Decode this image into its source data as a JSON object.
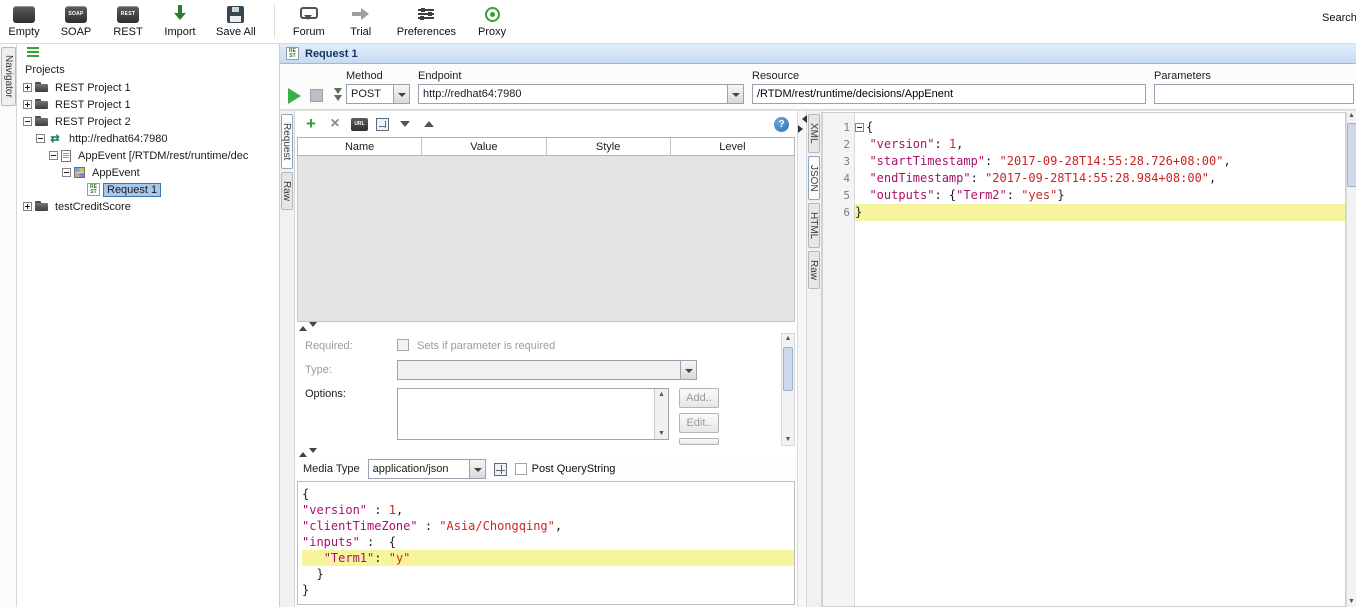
{
  "toolbar": {
    "items": [
      {
        "label": "Empty",
        "icon": "empty-project-icon"
      },
      {
        "label": "SOAP",
        "icon": "soap-project-icon"
      },
      {
        "label": "REST",
        "icon": "rest-project-icon"
      },
      {
        "label": "Import",
        "icon": "import-icon"
      },
      {
        "label": "Save All",
        "icon": "save-all-icon"
      },
      {
        "label": "Forum",
        "icon": "forum-icon"
      },
      {
        "label": "Trial",
        "icon": "trial-icon"
      },
      {
        "label": "Preferences",
        "icon": "preferences-icon"
      },
      {
        "label": "Proxy",
        "icon": "proxy-icon"
      }
    ],
    "search_label": "Search Forum"
  },
  "navigator": {
    "tab_label": "Navigator",
    "header": "Projects",
    "tree": [
      {
        "label": "REST Project 1",
        "icon": "folder",
        "level": 1,
        "expander": "collapsed",
        "selected": false
      },
      {
        "label": "REST Project 1",
        "icon": "folder",
        "level": 1,
        "expander": "collapsed",
        "selected": false
      },
      {
        "label": "REST Project 2",
        "icon": "folder",
        "level": 1,
        "expander": "expanded",
        "selected": false
      },
      {
        "label": "http://redhat64:7980",
        "icon": "service",
        "level": 2,
        "expander": "expanded",
        "selected": false
      },
      {
        "label": "AppEvent [/RTDM/rest/runtime/dec",
        "icon": "resource",
        "level": 3,
        "expander": "expanded",
        "selected": false
      },
      {
        "label": "AppEvent",
        "icon": "method",
        "level": 4,
        "expander": "expanded",
        "selected": false
      },
      {
        "label": "Request 1",
        "icon": "request",
        "level": 5,
        "expander": "none",
        "selected": true
      },
      {
        "label": "testCreditScore",
        "icon": "folder",
        "level": 1,
        "expander": "collapsed",
        "selected": false
      }
    ]
  },
  "request_window": {
    "title": "Request 1",
    "toolbar": {
      "method_label": "Method",
      "method_value": "POST",
      "endpoint_label": "Endpoint",
      "endpoint_value": "http://redhat64:7980",
      "resource_label": "Resource",
      "resource_value": "/RTDM/rest/runtime/decisions/AppEnent",
      "parameters_label": "Parameters",
      "parameters_value": ""
    },
    "side_tabs": [
      {
        "label": "Request",
        "selected": true
      },
      {
        "label": "Raw",
        "selected": false
      }
    ],
    "editor_toolbar_icons": [
      "add-param-icon",
      "delete-param-icon",
      "url-encode-icon",
      "grid-view-icon",
      "chevron-down-icon",
      "chevron-up-icon",
      "help-icon"
    ],
    "param_table": {
      "columns": [
        "Name",
        "Value",
        "Style",
        "Level"
      ],
      "rows": []
    },
    "details": {
      "required_label": "Required:",
      "required_checkbox_text": "Sets if parameter is required",
      "type_label": "Type:",
      "options_label": "Options:",
      "add_button": "Add..",
      "edit_button": "Edit.."
    },
    "media": {
      "label": "Media Type",
      "value": "application/json",
      "post_querystring": "Post QueryString"
    },
    "body_lines": [
      {
        "highlight": false,
        "segments": [
          [
            "p",
            "{"
          ]
        ]
      },
      {
        "highlight": false,
        "segments": [
          [
            "k",
            "\"version\""
          ],
          [
            "p",
            " : "
          ],
          [
            "v",
            "1"
          ],
          [
            "p",
            ","
          ]
        ]
      },
      {
        "highlight": false,
        "segments": [
          [
            "k",
            "\"clientTimeZone\""
          ],
          [
            "p",
            " : "
          ],
          [
            "v",
            "\"Asia/Chongqing\""
          ],
          [
            "p",
            ","
          ]
        ]
      },
      {
        "highlight": false,
        "segments": [
          [
            "k",
            "\"inputs\""
          ],
          [
            "p",
            " :  {"
          ]
        ]
      },
      {
        "highlight": true,
        "segments": [
          [
            "p",
            "   "
          ],
          [
            "k",
            "\"Term1\""
          ],
          [
            "p",
            ": "
          ],
          [
            "v",
            "\"y\""
          ]
        ]
      },
      {
        "highlight": false,
        "segments": [
          [
            "p",
            "  }"
          ]
        ]
      },
      {
        "highlight": false,
        "segments": [
          [
            "p",
            "}"
          ]
        ]
      }
    ]
  },
  "response_panel": {
    "side_tabs": [
      {
        "label": "XML",
        "selected": false
      },
      {
        "label": "JSON",
        "selected": true
      },
      {
        "label": "HTML",
        "selected": false
      },
      {
        "label": "Raw",
        "selected": false
      }
    ],
    "lines": [
      {
        "num": "1",
        "fold": true,
        "highlight": false,
        "segments": [
          [
            "p",
            "{"
          ]
        ]
      },
      {
        "num": "2",
        "fold": false,
        "highlight": false,
        "segments": [
          [
            "p",
            "  "
          ],
          [
            "k",
            "\"version\""
          ],
          [
            "p",
            ": "
          ],
          [
            "v",
            "1"
          ],
          [
            "p",
            ","
          ]
        ]
      },
      {
        "num": "3",
        "fold": false,
        "highlight": false,
        "segments": [
          [
            "p",
            "  "
          ],
          [
            "k",
            "\"startTimestamp\""
          ],
          [
            "p",
            ": "
          ],
          [
            "v",
            "\"2017-09-28T14:55:28.726+08:00\""
          ],
          [
            "p",
            ","
          ]
        ]
      },
      {
        "num": "4",
        "fold": false,
        "highlight": false,
        "segments": [
          [
            "p",
            "  "
          ],
          [
            "k",
            "\"endTimestamp\""
          ],
          [
            "p",
            ": "
          ],
          [
            "v",
            "\"2017-09-28T14:55:28.984+08:00\""
          ],
          [
            "p",
            ","
          ]
        ]
      },
      {
        "num": "5",
        "fold": false,
        "highlight": false,
        "segments": [
          [
            "p",
            "  "
          ],
          [
            "k",
            "\"outputs\""
          ],
          [
            "p",
            ": {"
          ],
          [
            "k",
            "\"Term2\""
          ],
          [
            "p",
            ": "
          ],
          [
            "v",
            "\"yes\""
          ],
          [
            "p",
            "}"
          ]
        ]
      },
      {
        "num": "6",
        "fold": false,
        "highlight": true,
        "segments": [
          [
            "p",
            "}"
          ]
        ]
      }
    ]
  },
  "colors": {
    "json_key": "#a9116d",
    "json_value": "#cc2424",
    "line_highlight": "#f6f59e",
    "tree_selection": "#a8c7ec",
    "titlebar": "#c5daf2"
  }
}
